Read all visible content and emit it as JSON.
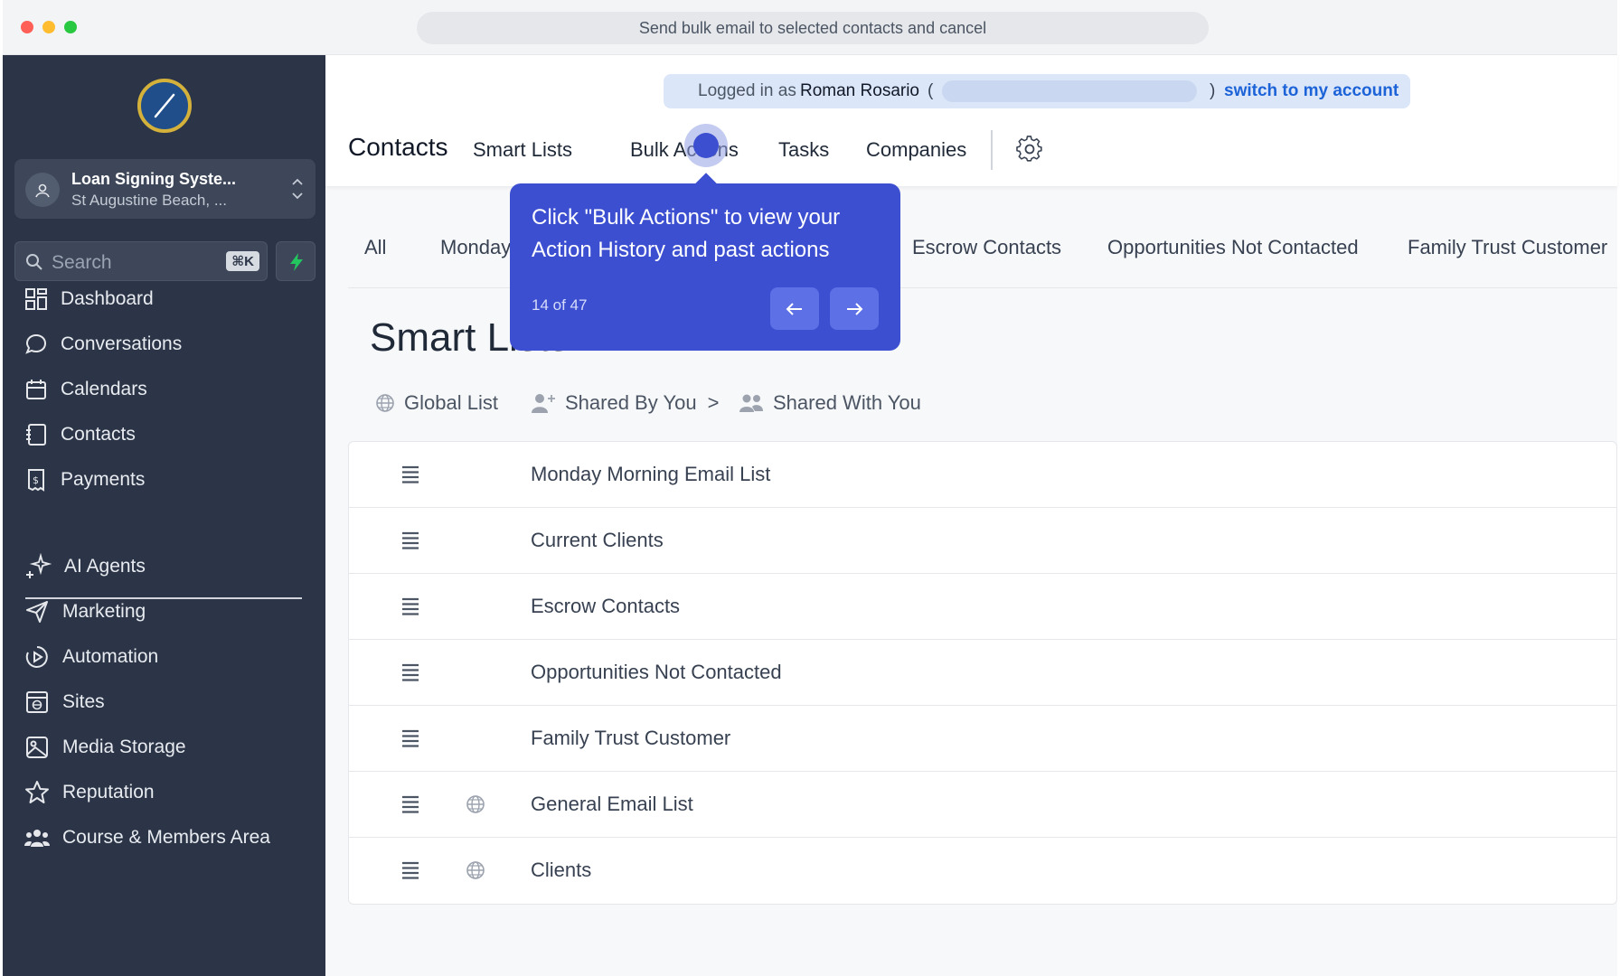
{
  "browser": {
    "address_text": "Send bulk email to selected contacts and cancel"
  },
  "sidebar": {
    "account": {
      "name": "Loan Signing Syste...",
      "location": "St Augustine Beach, ..."
    },
    "search": {
      "placeholder": "Search",
      "shortcut": "⌘K"
    },
    "items_primary": [
      {
        "label": "Dashboard",
        "icon": "dashboard-icon"
      },
      {
        "label": "Conversations",
        "icon": "chat-bubble-icon"
      },
      {
        "label": "Calendars",
        "icon": "calendar-icon"
      },
      {
        "label": "Contacts",
        "icon": "contacts-book-icon"
      },
      {
        "label": "Payments",
        "icon": "receipt-icon"
      }
    ],
    "items_secondary": [
      {
        "label": "AI Agents",
        "icon": "sparkle-icon"
      },
      {
        "label": "Marketing",
        "icon": "paper-plane-icon"
      },
      {
        "label": "Automation",
        "icon": "play-circle-icon"
      },
      {
        "label": "Sites",
        "icon": "web-page-icon"
      },
      {
        "label": "Media Storage",
        "icon": "image-icon"
      },
      {
        "label": "Reputation",
        "icon": "star-icon"
      },
      {
        "label": "Course & Members Area",
        "icon": "users-group-icon"
      }
    ]
  },
  "login_banner": {
    "prefix": "Logged in as",
    "user": "Roman Rosario",
    "paren_open": "(",
    "paren_close": ")",
    "switch_label": "switch to my account"
  },
  "header": {
    "title": "Contacts",
    "nav": [
      "Smart Lists",
      "Bulk Actions",
      "Tasks",
      "Companies"
    ]
  },
  "list_tabs": [
    "All",
    "Monday",
    "Escrow Contacts",
    "Opportunities Not Contacted",
    "Family Trust Customer"
  ],
  "smart_lists": {
    "title": "Smart Lists",
    "filters": {
      "global": "Global List",
      "shared_by_you": "Shared By You",
      "chevron": ">",
      "shared_with_you": "Shared With You"
    },
    "rows": [
      {
        "name": "Monday Morning Email List",
        "global": false
      },
      {
        "name": "Current Clients",
        "global": false
      },
      {
        "name": "Escrow Contacts",
        "global": false
      },
      {
        "name": "Opportunities Not Contacted",
        "global": false
      },
      {
        "name": "Family Trust Customer",
        "global": false
      },
      {
        "name": "General Email List",
        "global": true
      },
      {
        "name": "Clients",
        "global": true
      }
    ]
  },
  "tooltip": {
    "message": "Click \"Bulk Actions\" to view your Action History and past actions",
    "step": "14 of 47"
  },
  "colors": {
    "sidebar_bg": "#2b3547",
    "tooltip_bg": "#3c4fd0",
    "link": "#1d63d8"
  }
}
